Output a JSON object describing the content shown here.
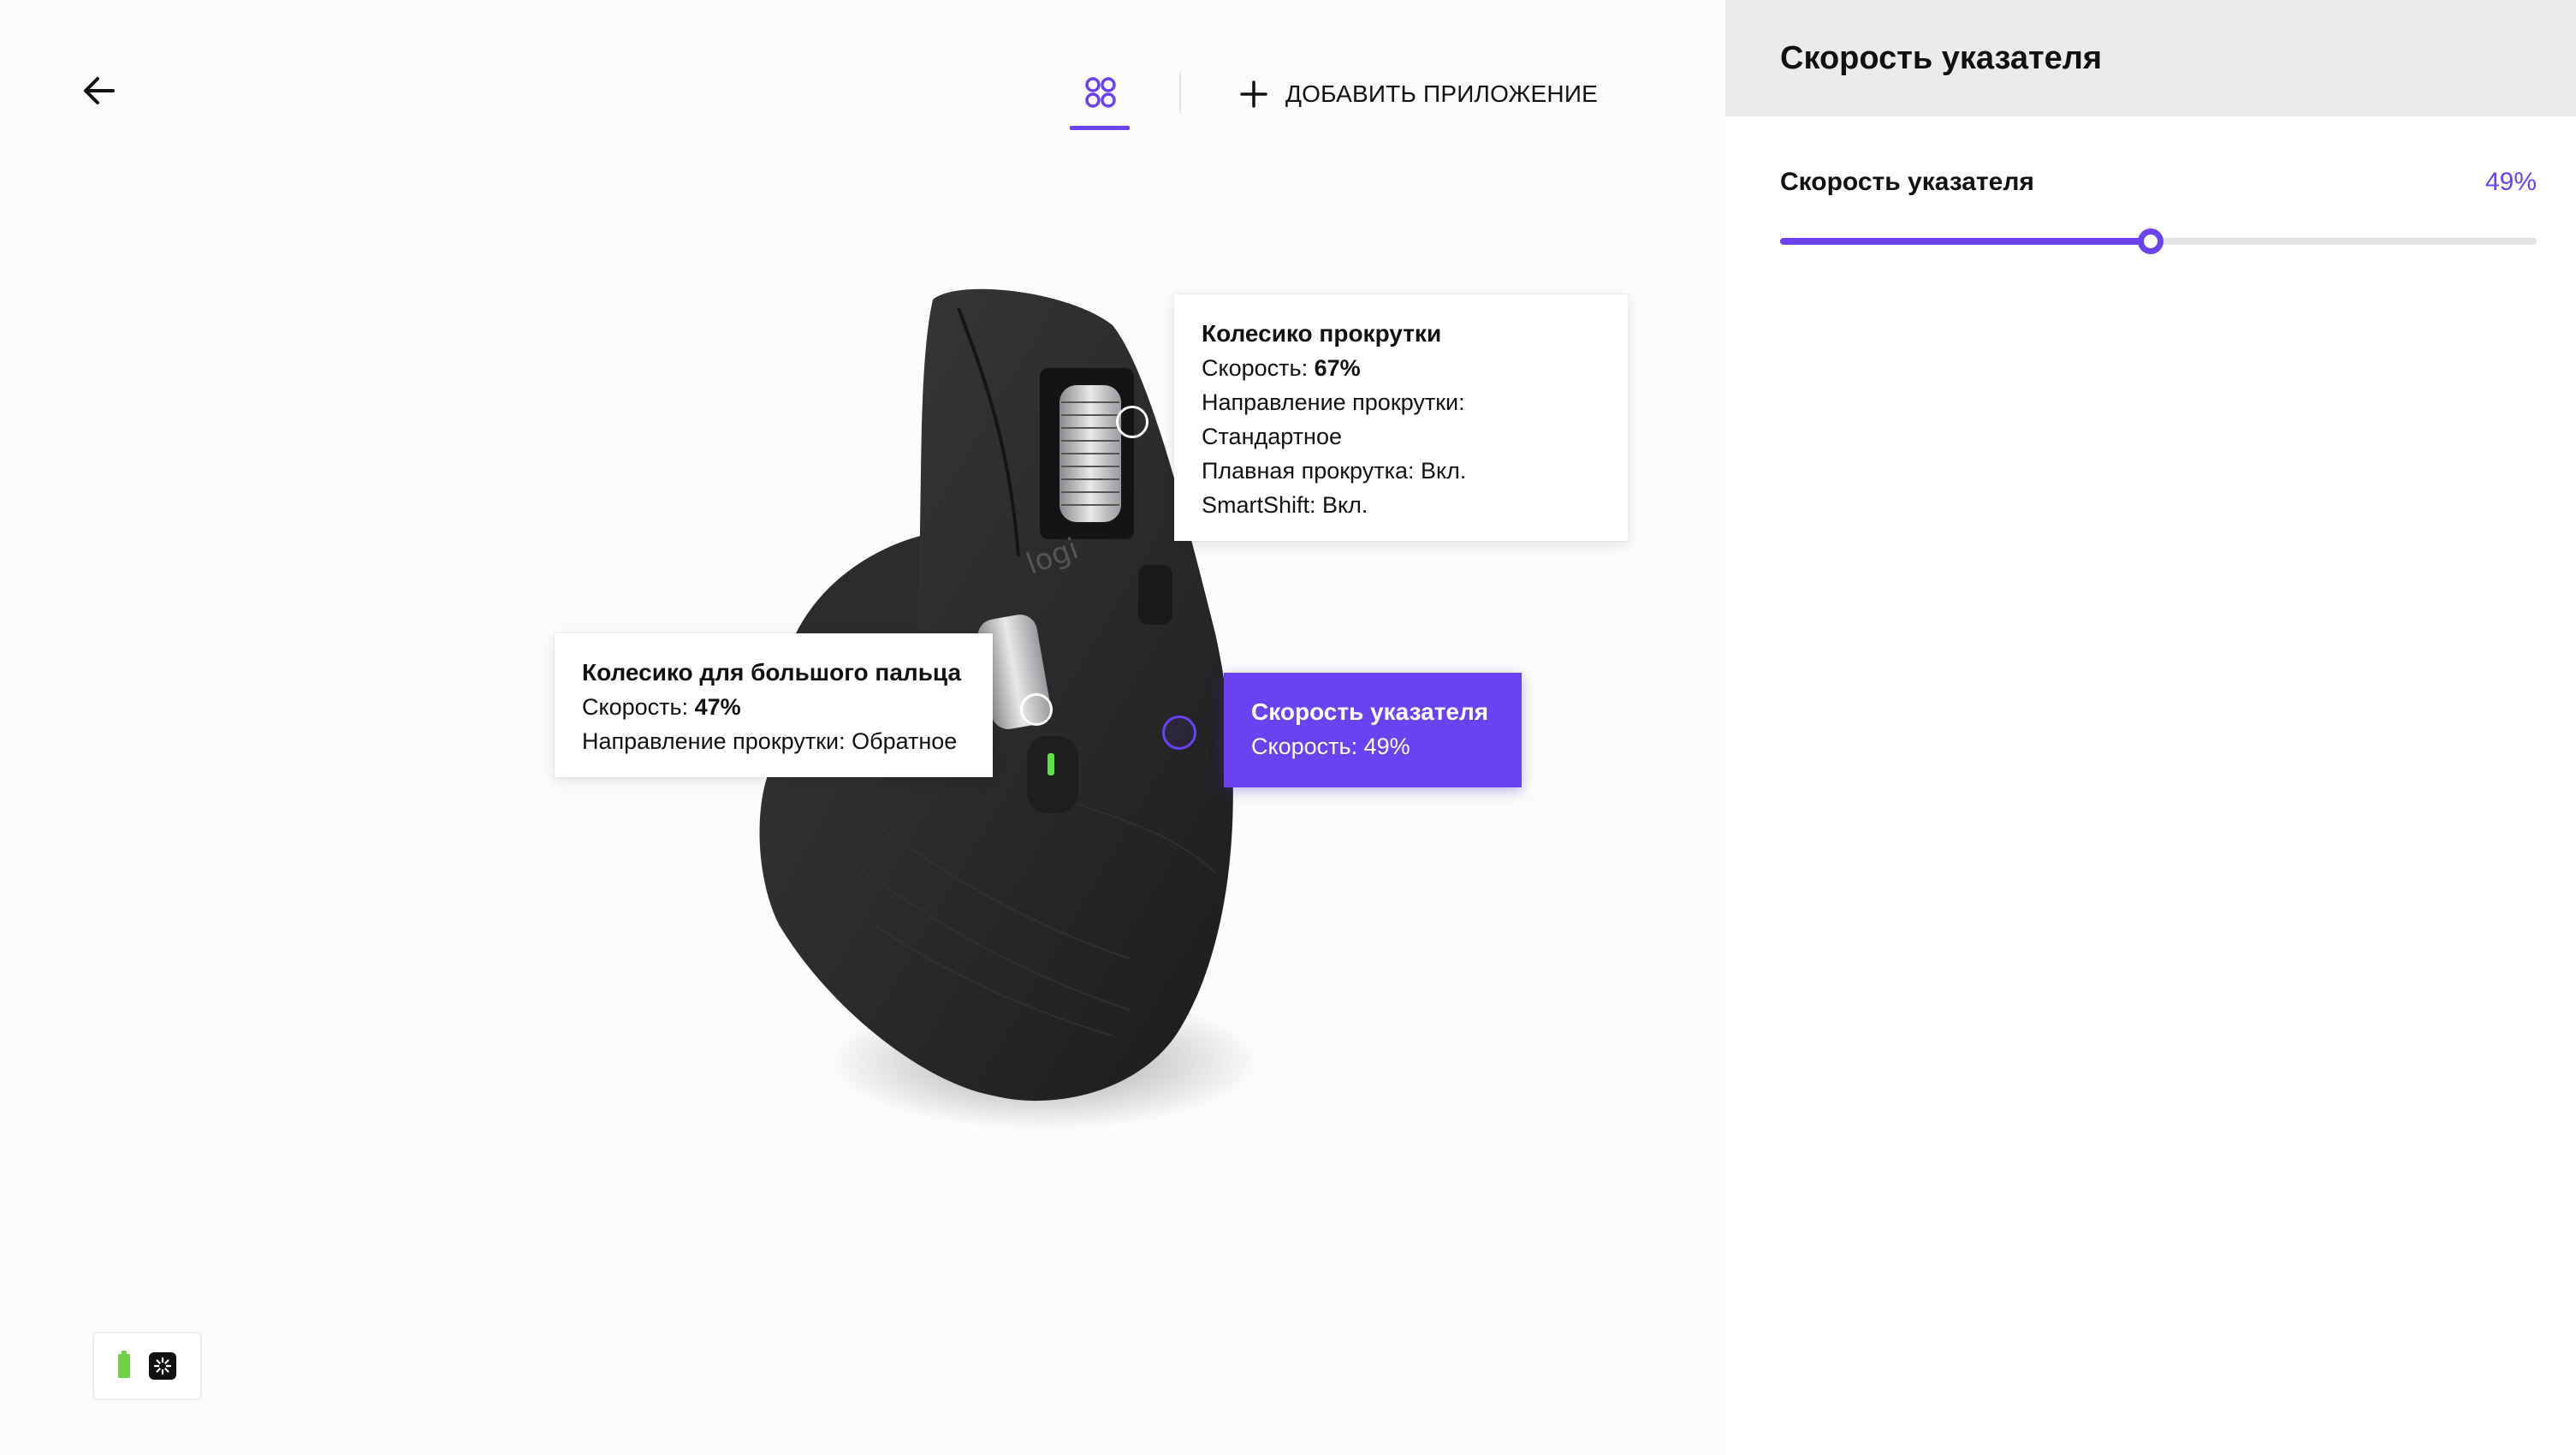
{
  "window": {
    "controls": [
      "close",
      "minimize",
      "zoom"
    ]
  },
  "toolbar": {
    "back_icon": "arrow-left-icon",
    "apps_icon": "apps-grid-icon",
    "add_app_icon": "plus-icon",
    "add_app_label": "ДОБАВИТЬ ПРИЛОЖЕНИЕ"
  },
  "callouts": {
    "scroll_wheel": {
      "title": "Колесико прокрутки",
      "speed_label": "Скорость:",
      "speed_value": "67%",
      "direction_label": "Направление прокрутки:",
      "direction_value": "Стандартное",
      "smooth_scroll": "Плавная прокрутка: Вкл.",
      "smartshift": "SmartShift: Вкл."
    },
    "thumb_wheel": {
      "title": "Колесико для большого пальца",
      "speed_label": "Скорость:",
      "speed_value": "47%",
      "direction": "Направление прокрутки: Обратное"
    },
    "pointer_speed": {
      "title": "Скорость указателя",
      "speed": "Скорость: 49%"
    }
  },
  "mouse": {
    "brand_mark": "logi"
  },
  "device_status": {
    "battery_icon": "battery-icon",
    "receiver_icon": "receiver-icon"
  },
  "panel": {
    "title": "Скорость указателя",
    "setting_label": "Скорость указателя",
    "setting_value": "49%",
    "slider_percent": 49
  },
  "colors": {
    "accent": "#6b42f1",
    "panel_header_bg": "#ebebeb",
    "battery": "#6fd146"
  }
}
